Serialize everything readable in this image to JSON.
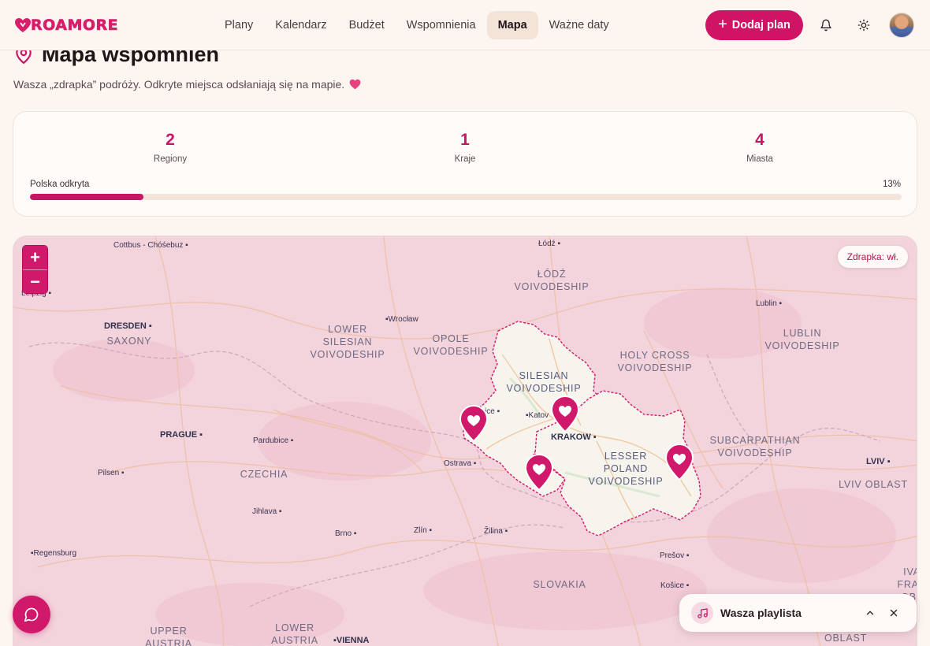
{
  "app": {
    "name": "ROAMORE"
  },
  "nav": {
    "items": [
      {
        "label": "Plany"
      },
      {
        "label": "Kalendarz"
      },
      {
        "label": "Budżet"
      },
      {
        "label": "Wspomnienia"
      },
      {
        "label": "Mapa",
        "active": true
      },
      {
        "label": "Ważne daty"
      }
    ],
    "add_plan_label": "Dodaj plan"
  },
  "page": {
    "title": "Mapa wspomnień",
    "subtitle": "Wasza „zdrapka” podróży. Odkryte miejsca odsłaniają się na mapie."
  },
  "stats": {
    "regions": {
      "value": "2",
      "label": "Regiony"
    },
    "countries": {
      "value": "1",
      "label": "Kraje"
    },
    "cities": {
      "value": "4",
      "label": "Miasta"
    },
    "progress_label": "Polska odkryta",
    "progress_percent_text": "13%",
    "progress_fraction": 0.13
  },
  "map": {
    "zoom_in": "+",
    "zoom_out": "−",
    "scratch_toggle": "Zdrapka: wł.",
    "cities": {
      "cottbus": "Cottbus - Chóśebuz",
      "lodz": "Łódź",
      "leipzig": "Leipzig",
      "lublin": "Lublin",
      "dresden": "DRESDEN",
      "wroclaw": "Wrocław",
      "katowice": "Katov",
      "ostrava": "Ostrava",
      "krakow": "KRAKOW",
      "prague": "PRAGUE",
      "pardubice": "Pardubice",
      "lviv": "LVIV",
      "pilsen": "Pilsen",
      "jihlava": "Jihlava",
      "brno": "Brno",
      "zlin": "Zlín",
      "zilina": "Žilina",
      "regensburg": "Regensburg",
      "presov": "Prešov",
      "kosice": "Košice",
      "vienna": "VIENNA",
      "gliwice": "ice"
    },
    "regions": {
      "saxony": "SAXONY",
      "lodz_voiv": [
        "ŁÓDŹ",
        "VOIVODESHIP"
      ],
      "lower_silesian": [
        "LOWER",
        "SILESIAN",
        "VOIVODESHIP"
      ],
      "opole": [
        "OPOLE",
        "VOIVODESHIP"
      ],
      "holy_cross": [
        "HOLY CROSS",
        "VOIVODESHIP"
      ],
      "lublin_voiv": [
        "LUBLIN",
        "VOIVODESHIP"
      ],
      "silesian": [
        "SILESIAN",
        "VOIVODESHIP"
      ],
      "lesser_poland": [
        "LESSER",
        "POLAND",
        "VOIVODESHIP"
      ],
      "subcarpathian": [
        "SUBCARPATHIAN",
        "VOIVODESHIP"
      ],
      "czechia": "CZECHIA",
      "lviv_oblast": "LVIV OBLAST",
      "slovakia": "SLOVAKIA",
      "upper_austria": [
        "UPPER",
        "AUSTRIA"
      ],
      "lower_austria": [
        "LOWER",
        "AUSTRIA"
      ],
      "ivano": [
        "IVA",
        "FRAN",
        "OBL"
      ],
      "oblast": "OBLAST"
    },
    "pins": 4
  },
  "playlist": {
    "title": "Wasza playlista"
  },
  "colors": {
    "accent": "#cf1466",
    "scratch": "#f3d3dc",
    "revealed": "#f7f4ee"
  }
}
